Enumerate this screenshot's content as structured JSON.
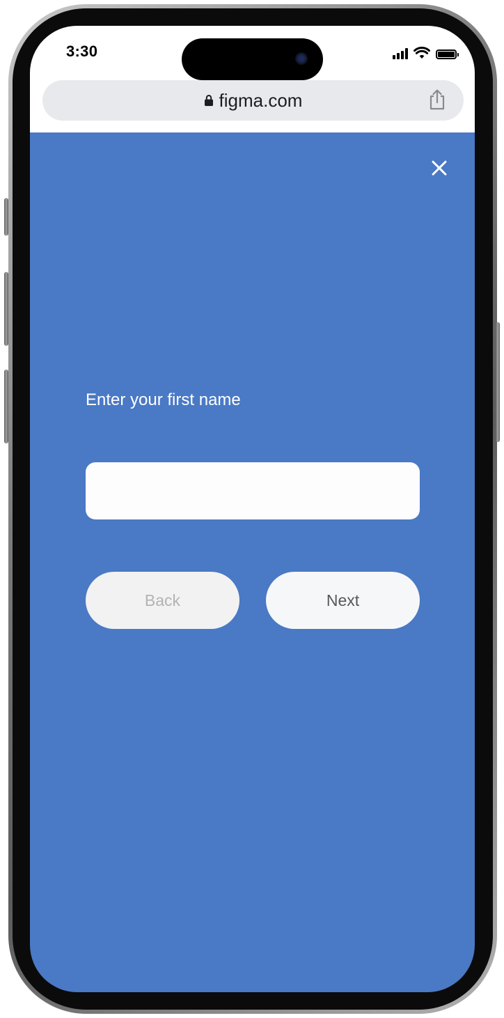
{
  "status_bar": {
    "time": "3:30"
  },
  "browser": {
    "url": "figma.com",
    "lock_icon": "lock-icon",
    "share_icon": "share-icon"
  },
  "form": {
    "prompt": "Enter your first name",
    "first_name_value": "",
    "back_label": "Back",
    "next_label": "Next",
    "close_icon": "close-icon"
  },
  "colors": {
    "background": "#4a79c5",
    "text_on_background": "#ffffff",
    "back_disabled_text": "#b3b3b3",
    "next_text": "#555a58"
  }
}
